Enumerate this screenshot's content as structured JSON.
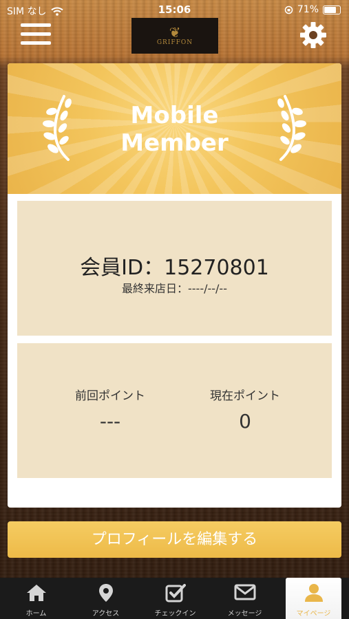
{
  "status_bar": {
    "carrier": "SIM なし",
    "time": "15:06",
    "battery_percent": "71%"
  },
  "header": {
    "logo_text": "GRIFFON"
  },
  "banner": {
    "title_line1": "Mobile",
    "title_line2": "Member"
  },
  "member": {
    "id_text": "会員ID：15270801",
    "last_visit_text": "最終来店日：----/--/--"
  },
  "points": {
    "previous_label": "前回ポイント",
    "previous_value": "---",
    "current_label": "現在ポイント",
    "current_value": "0"
  },
  "edit_profile_label": "プロフィールを編集する",
  "tabs": [
    {
      "label": "ホーム",
      "icon": "home-icon"
    },
    {
      "label": "アクセス",
      "icon": "location-pin-icon"
    },
    {
      "label": "チェックイン",
      "icon": "checkbox-icon"
    },
    {
      "label": "メッセージ",
      "icon": "envelope-icon"
    },
    {
      "label": "マイページ",
      "icon": "user-icon",
      "active": true
    }
  ],
  "colors": {
    "accent": "#edba48",
    "panel": "#f0e2c6",
    "tabbar": "#1b1b1b"
  }
}
